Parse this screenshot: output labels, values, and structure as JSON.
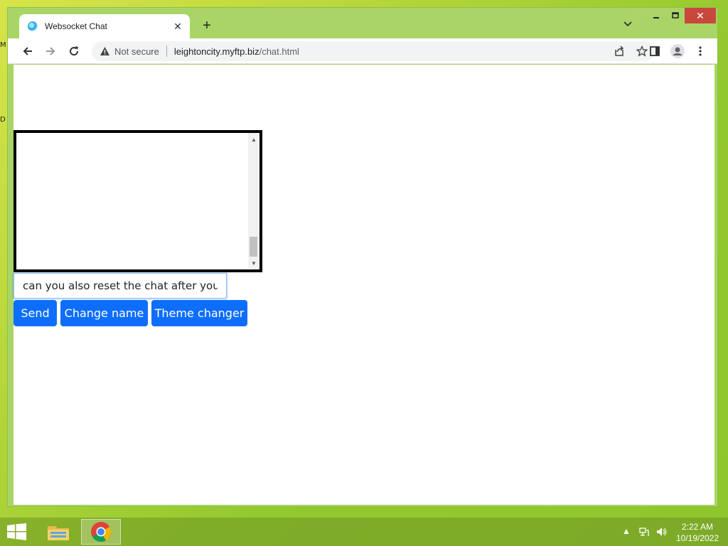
{
  "browser": {
    "tab_title": "Websocket Chat",
    "security_label": "Not secure",
    "url_host": "leightoncity.myftp.biz",
    "url_path": "/chat.html"
  },
  "chat": {
    "input_value": "can you also reset the chat after you",
    "send_label": "Send",
    "change_name_label": "Change name",
    "theme_changer_label": "Theme changer"
  },
  "taskbar": {
    "time": "2:22 AM",
    "date": "10/19/2022"
  },
  "colors": {
    "button_primary": "#0d6efd",
    "close_button": "#c9473d"
  }
}
